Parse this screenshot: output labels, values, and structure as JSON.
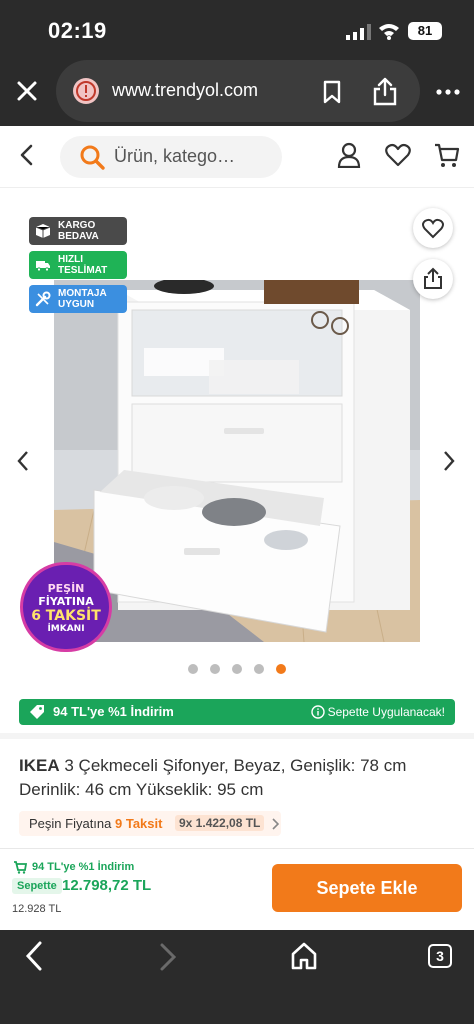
{
  "status_bar": {
    "time": "02:19",
    "battery": "81"
  },
  "browser": {
    "url": "www.trendyol.com",
    "tab_count": "3"
  },
  "header": {
    "search_placeholder": "Ürün, katego…"
  },
  "badges": [
    {
      "line1": "KARGO",
      "line2": "BEDAVA",
      "color": "#4a4a4a"
    },
    {
      "line1": "HIZLI",
      "line2": "TESLİMAT",
      "color": "#1fb356"
    },
    {
      "line1": "MONTAJA",
      "line2": "UYGUN",
      "color": "#3b8fe0"
    }
  ],
  "installment_sticker": {
    "l1": "PEŞİN",
    "l2": "FİYATINA",
    "l3": "6 TAKSİT",
    "l4": "İMKANI"
  },
  "promo": {
    "left": "94 TL'ye %1 İndirim",
    "right": "Sepette Uygulanacak!"
  },
  "product": {
    "brand": "IKEA",
    "title": "3 Çekmeceli Şifonyer, Beyaz, Genişlik: 78 cm Derinlik: 46 cm  Yükseklik: 95 cm",
    "installment_label": "Peşin Fiyatına",
    "installment_highlight": "9 Taksit",
    "installment_amount": "9x 1.422,08 TL"
  },
  "cart_bar": {
    "discount": "94 TL'ye %1 İndirim",
    "basket_label": "Sepette",
    "basket_price": "12.798,72 TL",
    "old_price": "12.928 TL",
    "add_button": "Sepete Ekle"
  },
  "gallery": {
    "image_count": 5,
    "active_index": 4
  },
  "colors": {
    "accent": "#f27a1a",
    "green": "#1ba55a",
    "dark": "#2b2b2b"
  }
}
